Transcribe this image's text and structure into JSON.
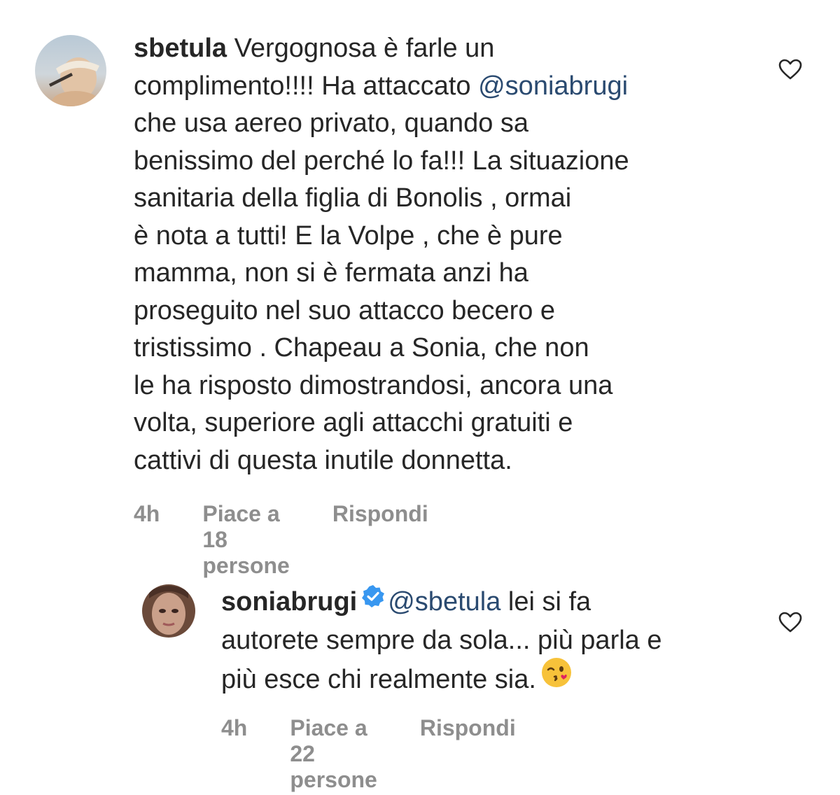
{
  "comments": [
    {
      "username": "sbetula",
      "lines": [
        "Vergognosa è farle un",
        "complimento!!!! Ha attaccato ",
        "che usa aereo privato, quando sa",
        "benissimo del perché lo fa!!! La situazione",
        "sanitaria della figlia di Bonolis , ormai",
        "è nota a tutti!  E la Volpe , che è pure",
        "mamma, non si è fermata anzi ha",
        "proseguito nel suo attacco becero e",
        "tristissimo .  Chapeau a Sonia, che non",
        "le ha risposto dimostrandosi, ancora una",
        "volta, superiore agli attacchi gratuiti e",
        "cattivi di questa inutile donnetta."
      ],
      "mention": "@soniabrugi",
      "time": "4h",
      "likes": "Piace a 18 persone",
      "reply": "Rispondi",
      "like_icon": "heart-outline-icon"
    },
    {
      "username": "soniabrugi",
      "verified_icon": "verified-badge-icon",
      "mention": "@sbetula",
      "lines": [
        " lei si fa",
        "autorete sempre da sola... più parla e",
        "più esce chi realmente sia."
      ],
      "emoji": "kiss-wink-emoji",
      "time": "4h",
      "likes": "Piace a 22 persone",
      "reply": "Rispondi",
      "like_icon": "heart-outline-icon"
    }
  ],
  "colors": {
    "text": "#262626",
    "meta": "#8e8e8e",
    "mention": "#2a4a70",
    "verified": "#3897f0"
  }
}
